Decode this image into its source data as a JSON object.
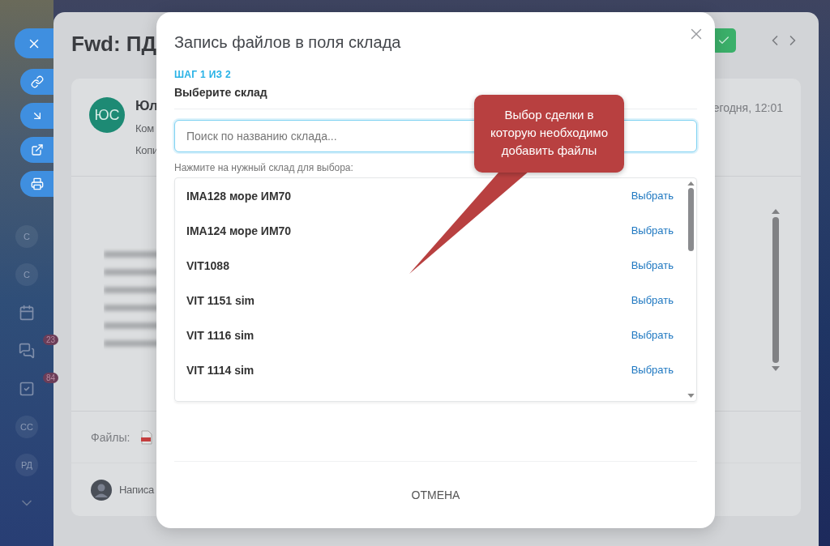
{
  "sidebar": {
    "items": [
      {
        "kind": "letter",
        "label": "С"
      },
      {
        "kind": "letter",
        "label": "С"
      },
      {
        "kind": "calendar"
      },
      {
        "kind": "chat",
        "badge": "23"
      },
      {
        "kind": "tasks",
        "badge": "84"
      },
      {
        "kind": "letter",
        "label": "СС"
      },
      {
        "kind": "letter",
        "label": "РД"
      },
      {
        "kind": "more"
      }
    ]
  },
  "actions": [
    {
      "kind": "close"
    },
    {
      "kind": "link"
    },
    {
      "kind": "download"
    },
    {
      "kind": "share"
    },
    {
      "kind": "print"
    }
  ],
  "email": {
    "subject": "Fwd: ПД",
    "sender_initials": "ЮС",
    "sender": "Юл",
    "to_label": "Ком",
    "cc_label": "Копи",
    "date": "егодня, 12:01",
    "files_label": "Файлы:",
    "reply_placeholder": "Написа"
  },
  "dialog": {
    "title": "Запись файлов в поля склада",
    "step": "ШАГ 1 ИЗ 2",
    "subtitle": "Выберите склад",
    "search": {
      "placeholder": "Поиск по названию склада..."
    },
    "hint": "Нажмите на нужный склад для выбора:",
    "warehouses": [
      {
        "name": "IMA128 море ИМ70",
        "action": "Выбрать"
      },
      {
        "name": "IMA124 море ИМ70",
        "action": "Выбрать"
      },
      {
        "name": "VIT1088",
        "action": "Выбрать"
      },
      {
        "name": "VIT 1151 sim",
        "action": "Выбрать"
      },
      {
        "name": "VIT 1116 sim",
        "action": "Выбрать"
      },
      {
        "name": "VIT 1114 sim",
        "action": "Выбрать"
      }
    ],
    "cancel": "ОТМЕНА"
  },
  "callout": {
    "text": "Выбор сделки в которую необходимо добавить файлы"
  }
}
